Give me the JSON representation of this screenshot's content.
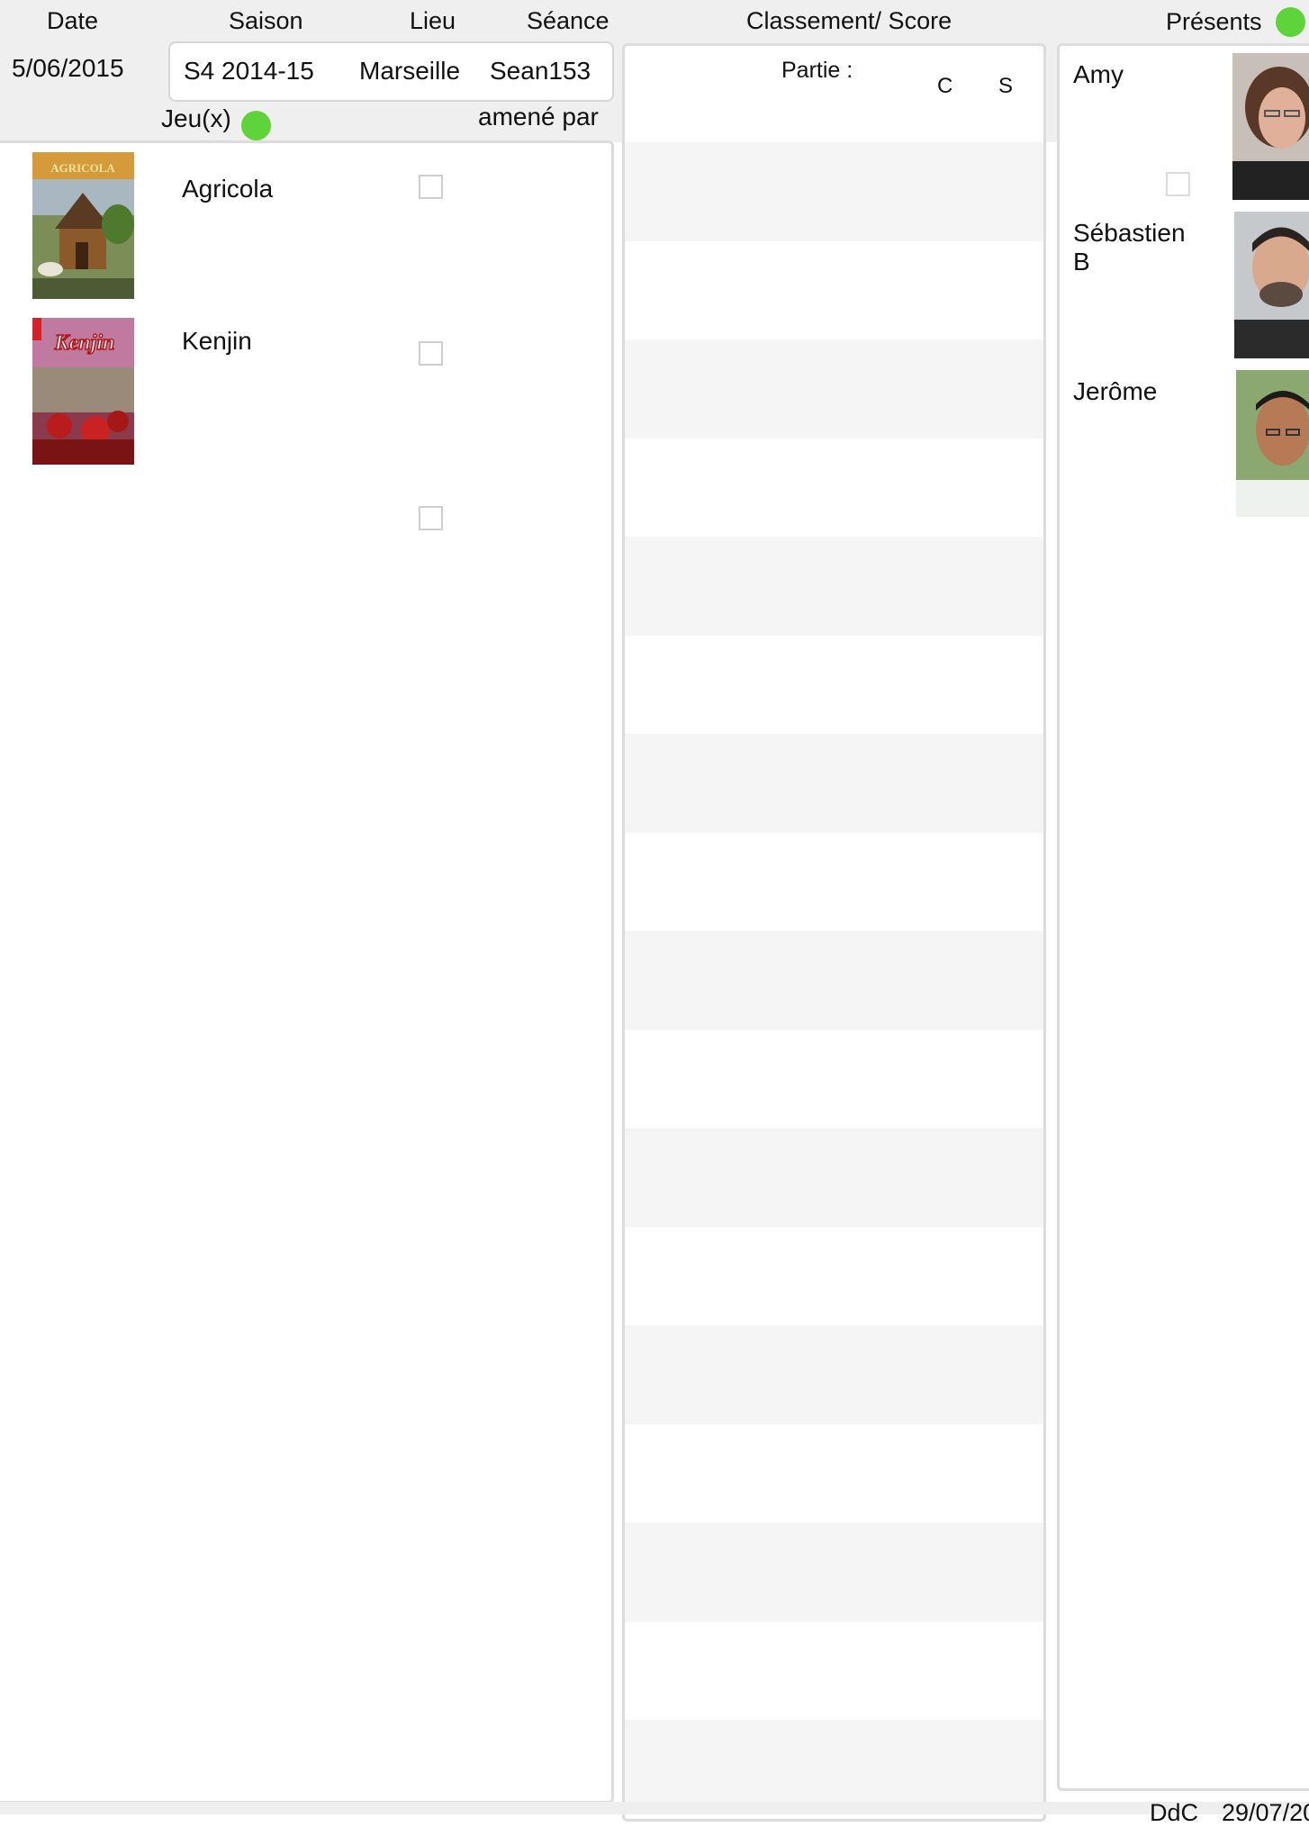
{
  "header": {
    "date_label": "Date",
    "saison_label": "Saison",
    "lieu_label": "Lieu",
    "seance_label": "Séance",
    "classement_label": "Classement/ Score",
    "presents_label": "Présents"
  },
  "session": {
    "date": "5/06/2015",
    "saison": "S4 2014-15",
    "lieu": "Marseille",
    "seance": "Sean153"
  },
  "games_section": {
    "jeux_label": "Jeu(x)",
    "amene_par_label": "amené par",
    "games": [
      {
        "name": "Agricola",
        "cover_icon": "agricola-cover-image",
        "checked": false
      },
      {
        "name": "Kenjin",
        "cover_icon": "kenjin-cover-image",
        "checked": false
      },
      {
        "name": "",
        "cover_icon": "",
        "checked": false
      }
    ]
  },
  "scores": {
    "partie_label": "Partie :",
    "col_c": "C",
    "col_s": "S"
  },
  "players": [
    {
      "name": "Amy",
      "photo_icon": "amy-avatar"
    },
    {
      "name": "Sébastien B",
      "photo_icon": "sebastien-avatar"
    },
    {
      "name": "Jerôme",
      "photo_icon": "jerome-avatar"
    }
  ],
  "footer": {
    "ddc_label": "DdC",
    "ddc_date": "29/07/20"
  },
  "colors": {
    "status_dot": "#5fd43a",
    "band": "#efefef",
    "row_shade": "#f5f5f5"
  }
}
